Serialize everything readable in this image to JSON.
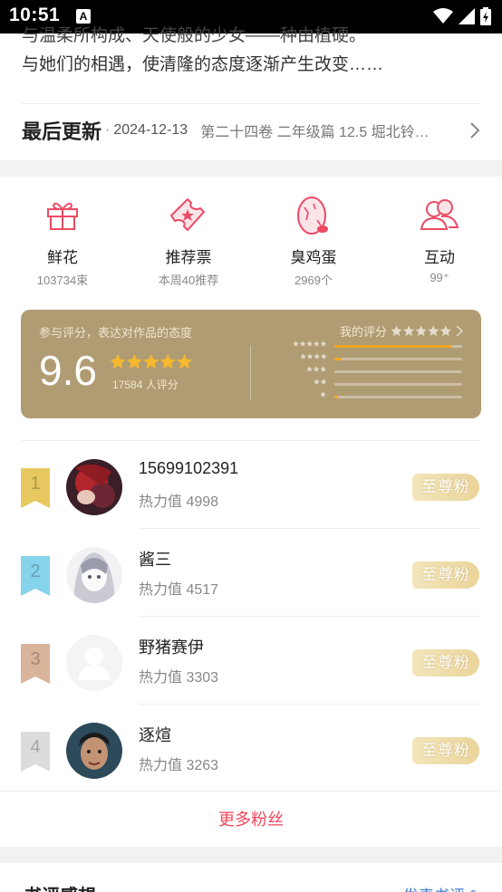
{
  "status_bar": {
    "time": "10:51",
    "a_icon": "A"
  },
  "intro": {
    "line1": "与温柔所构成、天使般的少女——种由植硬。",
    "line2": "与她们的相遇，使清隆的态度逐渐产生改变……"
  },
  "update": {
    "label": "最后更新",
    "dot": "·",
    "date": "2024-12-13",
    "chapter": "第二十四卷 二年级篇 12.5 堀北铃…"
  },
  "gifts": [
    {
      "name": "鲜花",
      "sub": "103734束",
      "icon": "gift-icon"
    },
    {
      "name": "推荐票",
      "sub": "本周40推荐",
      "icon": "ticket-icon"
    },
    {
      "name": "臭鸡蛋",
      "sub": "2969个",
      "icon": "egg-icon"
    },
    {
      "name": "互动",
      "sub": "99⁺",
      "icon": "people-icon"
    }
  ],
  "rating": {
    "hint": "参与评分，表达对作品的态度",
    "score": "9.6",
    "count": "17584 人评分",
    "my_rating_label": "我的评分",
    "distribution": [
      0.92,
      0.06,
      0.0,
      0.0,
      0.02
    ]
  },
  "fans": [
    {
      "rank": "1",
      "name": "15699102391",
      "heat": "热力值 4998",
      "badge": "至尊粉",
      "rank_color": "#e8c860"
    },
    {
      "rank": "2",
      "name": "酱三",
      "heat": "热力值 4517",
      "badge": "至尊粉",
      "rank_color": "#86d3ec"
    },
    {
      "rank": "3",
      "name": "野猪赛伊",
      "heat": "热力值 3303",
      "badge": "至尊粉",
      "rank_color": "#d9b49b"
    },
    {
      "rank": "4",
      "name": "逐煊",
      "heat": "热力值 3263",
      "badge": "至尊粉",
      "rank_color": "#dcdcdc"
    }
  ],
  "more_fans": "更多粉丝",
  "reviews": {
    "title": "书评感想",
    "write": "发表书评 ✎"
  },
  "colors": {
    "accent": "#f0465c",
    "rating_bg": "#b09c73",
    "bar": "#f5a623"
  }
}
